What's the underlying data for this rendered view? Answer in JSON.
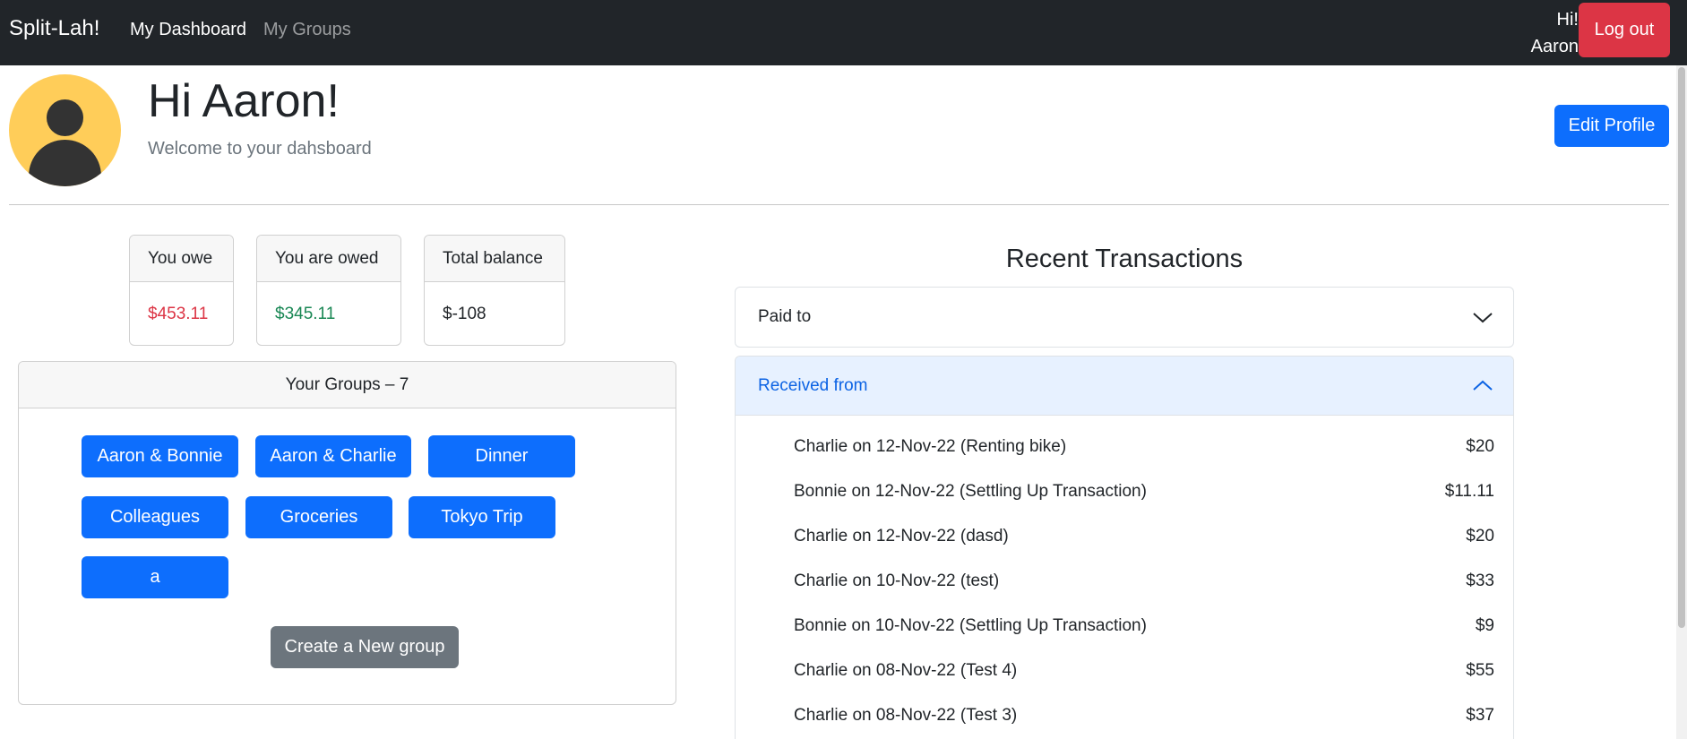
{
  "navbar": {
    "brand": "Split-Lah!",
    "links": [
      "My Dashboard",
      "My Groups"
    ],
    "greeting_line1": "Hi!",
    "greeting_line2": "Aaron",
    "logout": "Log out"
  },
  "header": {
    "title": "Hi Aaron!",
    "subtitle": "Welcome to your dahsboard",
    "edit_profile": "Edit Profile"
  },
  "summary": {
    "owe": {
      "label": "You owe",
      "value": "$453.11"
    },
    "owed": {
      "label": "You are owed",
      "value": "$345.11"
    },
    "total": {
      "label": "Total balance",
      "value": "$-108"
    }
  },
  "groups": {
    "header": "Your Groups – 7",
    "items": [
      "Aaron & Bonnie",
      "Aaron & Charlie",
      "Dinner",
      "Colleagues",
      "Groceries",
      "Tokyo Trip",
      "a"
    ],
    "create": "Create a New group"
  },
  "transactions": {
    "title": "Recent Transactions",
    "paid_to": "Paid to",
    "received_from": "Received from",
    "received": [
      {
        "desc": "Charlie on 12-Nov-22 (Renting bike)",
        "amount": "$20"
      },
      {
        "desc": "Bonnie on 12-Nov-22 (Settling Up Transaction)",
        "amount": "$11.11"
      },
      {
        "desc": "Charlie on 12-Nov-22 (dasd)",
        "amount": "$20"
      },
      {
        "desc": "Charlie on 10-Nov-22 (test)",
        "amount": "$33"
      },
      {
        "desc": "Bonnie on 10-Nov-22 (Settling Up Transaction)",
        "amount": "$9"
      },
      {
        "desc": "Charlie on 08-Nov-22 (Test 4)",
        "amount": "$55"
      },
      {
        "desc": "Charlie on 08-Nov-22 (Test 3)",
        "amount": "$37"
      }
    ]
  },
  "colors": {
    "navbar": "#212529",
    "primary": "#0d6efd",
    "danger": "#dc3545",
    "success": "#198754",
    "secondary": "#6c757d",
    "avatar": "#ffcd59",
    "accordion_active": "#e7f1ff"
  },
  "icons": [
    "user-avatar-icon",
    "chevron-down-icon",
    "chevron-up-icon"
  ]
}
